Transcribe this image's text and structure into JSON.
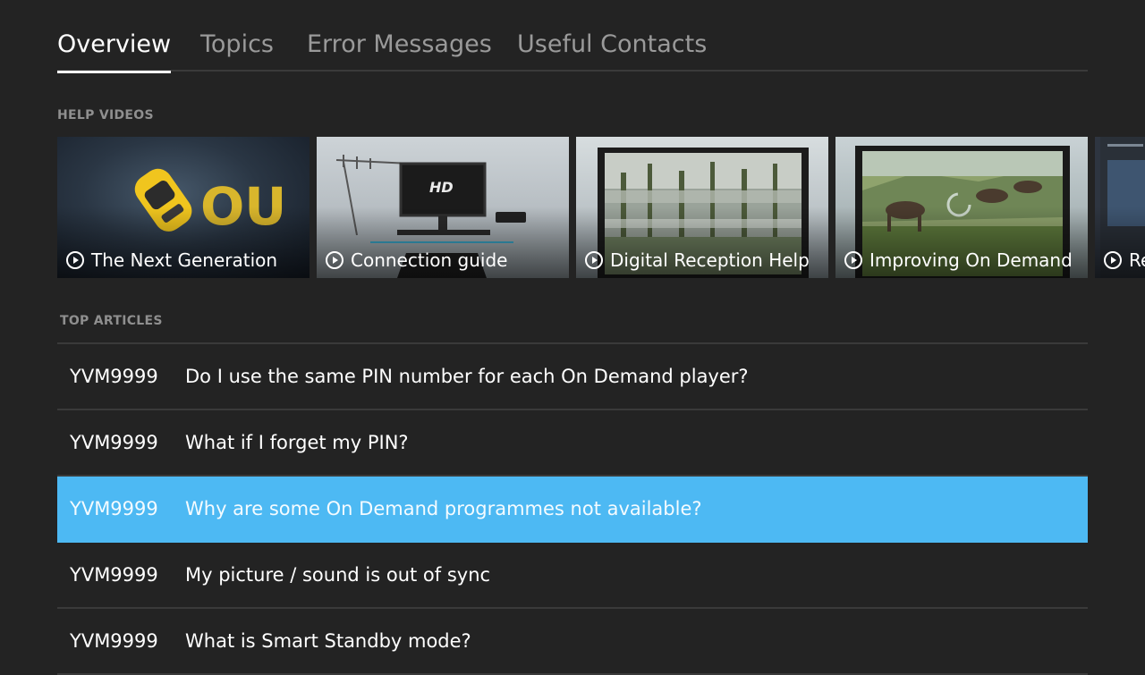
{
  "tabs": [
    {
      "label": "Overview",
      "active": true
    },
    {
      "label": "Topics",
      "active": false
    },
    {
      "label": "Error Messages",
      "active": false
    },
    {
      "label": "Useful Contacts",
      "active": false
    }
  ],
  "help_videos": {
    "heading": "HELP VIDEOS",
    "items": [
      {
        "title": "The Next Generation",
        "icon": "play-circle-icon"
      },
      {
        "title": "Connection guide",
        "icon": "play-circle-icon"
      },
      {
        "title": "Digital Reception Help",
        "icon": "play-circle-icon"
      },
      {
        "title": "Improving On Demand",
        "icon": "play-circle-icon"
      },
      {
        "title": "Re",
        "icon": "play-circle-icon"
      }
    ]
  },
  "top_articles": {
    "heading": "TOP ARTICLES",
    "items": [
      {
        "code": "YVM9999",
        "question": "Do I use the same PIN number for each On Demand player?"
      },
      {
        "code": "YVM9999",
        "question": "What if I forget my PIN?"
      },
      {
        "code": "YVM9999",
        "question": "Why are some On Demand programmes not available?",
        "selected": true
      },
      {
        "code": "YVM9999",
        "question": "My picture / sound is out of sync"
      },
      {
        "code": "YVM9999",
        "question": "What is Smart Standby mode?"
      }
    ]
  },
  "colors": {
    "background": "#232323",
    "highlight": "#4db9f3",
    "divider": "#3a3a3a"
  }
}
